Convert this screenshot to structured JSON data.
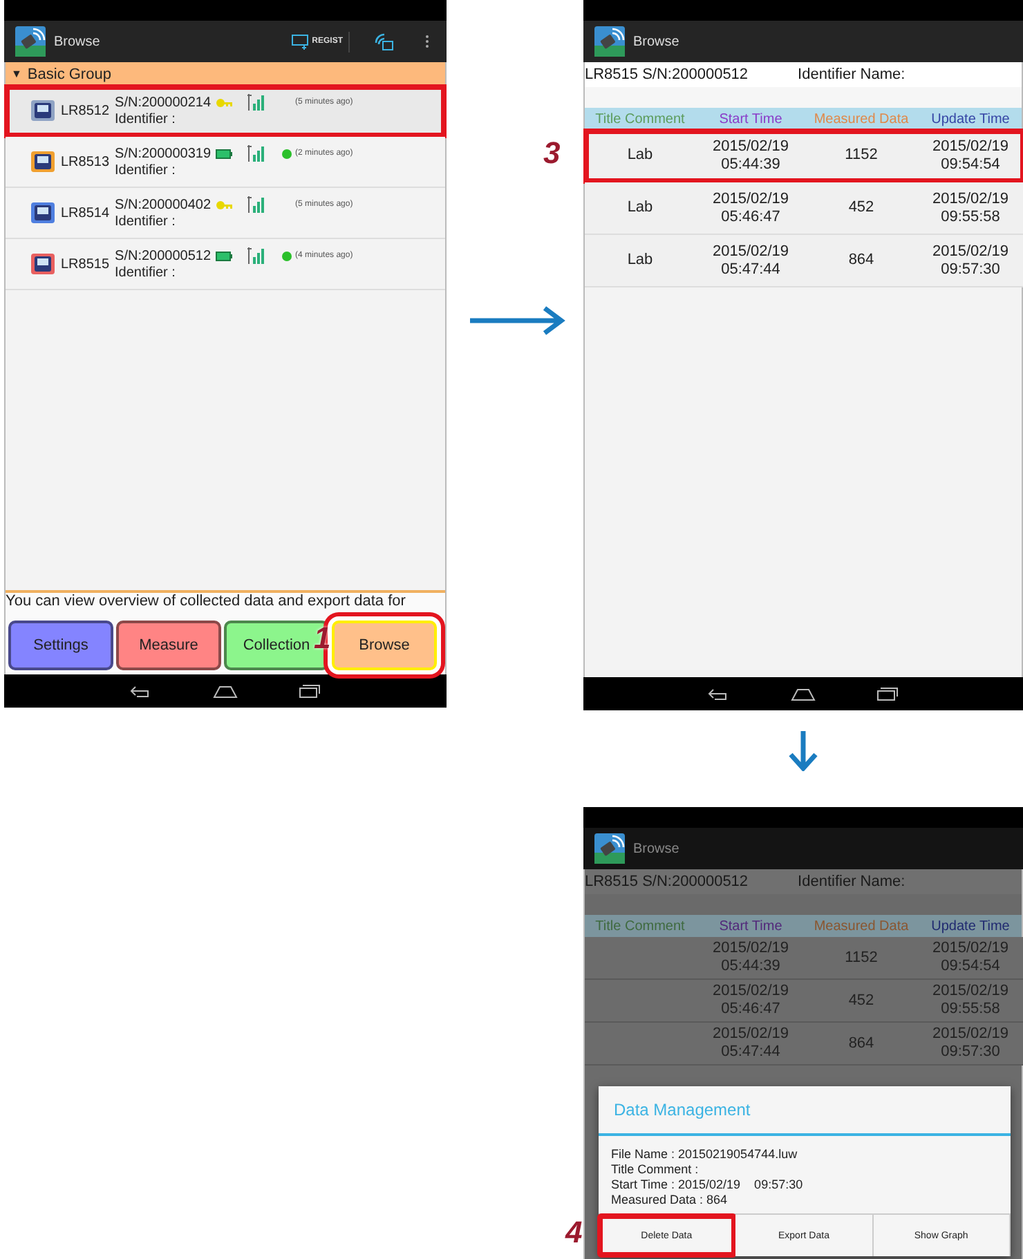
{
  "device_list_screen": {
    "app_bar": {
      "title": "Browse",
      "regist_label": "REGIST"
    },
    "group": {
      "toggle": "▼",
      "label": "Basic Group"
    },
    "devices": [
      {
        "model": "LR8512",
        "serial": "S/N:200000214",
        "identifier": "Identifier :",
        "updated": "(5 minutes ago)",
        "color": "#8fa3c4",
        "kind": "key",
        "online": false,
        "highlighted": true
      },
      {
        "model": "LR8513",
        "serial": "S/N:200000319",
        "identifier": "Identifier :",
        "updated": "(2 minutes ago)",
        "color": "#f0a030",
        "kind": "battery",
        "online": true,
        "highlighted": false
      },
      {
        "model": "LR8514",
        "serial": "S/N:200000402",
        "identifier": "Identifier :",
        "updated": "(5 minutes ago)",
        "color": "#4f7fe0",
        "kind": "key",
        "online": false,
        "highlighted": false
      },
      {
        "model": "LR8515",
        "serial": "S/N:200000512",
        "identifier": "Identifier :",
        "updated": "(4 minutes ago)",
        "color": "#e86060",
        "kind": "battery",
        "online": true,
        "highlighted": false
      }
    ],
    "hint": "You can view overview of collected data and export data for",
    "tabs": [
      {
        "label": "Settings",
        "color": "#8484ff",
        "selected": false,
        "highlighted": false
      },
      {
        "label": "Measure",
        "color": "#ff8484",
        "selected": false,
        "highlighted": false
      },
      {
        "label": "Collection",
        "color": "#8cf58c",
        "selected": false,
        "highlighted": false
      },
      {
        "label": "Browse",
        "color": "#ffc08a",
        "selected": true,
        "highlighted": true,
        "step": "1"
      }
    ]
  },
  "data_list_screen": {
    "app_bar": {
      "title": "Browse"
    },
    "device": "LR8515 S/N:200000512",
    "identifier": "Identifier Name:",
    "columns": [
      {
        "label": "Title Comment",
        "color": "#5c9c5c"
      },
      {
        "label": "Start Time",
        "color": "#8a3cc8"
      },
      {
        "label": "Measured Data",
        "color": "#e0894a"
      },
      {
        "label": "Update Time",
        "color": "#3545a5"
      }
    ],
    "rows": [
      {
        "comment": "Lab",
        "start": "2015/02/19\n05:44:39",
        "measured": "1152",
        "update": "2015/02/19\n09:54:54",
        "highlighted": true,
        "step": "3"
      },
      {
        "comment": "Lab",
        "start": "2015/02/19\n05:46:47",
        "measured": "452",
        "update": "2015/02/19\n09:55:58",
        "highlighted": false
      },
      {
        "comment": "Lab",
        "start": "2015/02/19\n05:47:44",
        "measured": "864",
        "update": "2015/02/19\n09:57:30",
        "highlighted": false
      }
    ]
  },
  "dialog_screen": {
    "app_bar": {
      "title": "Browse"
    },
    "device": "LR8515 S/N:200000512",
    "identifier": "Identifier Name:",
    "columns": [
      {
        "label": "Title Comment",
        "color": "#3f6a3f"
      },
      {
        "label": "Start Time",
        "color": "#52287a"
      },
      {
        "label": "Measured Data",
        "color": "#8a5630"
      },
      {
        "label": "Update Time",
        "color": "#202a70"
      }
    ],
    "rows": [
      {
        "start": "2015/02/19\n05:44:39",
        "measured": "1152",
        "update": "2015/02/19\n09:54:54"
      },
      {
        "start": "2015/02/19\n05:46:47",
        "measured": "452",
        "update": "2015/02/19\n09:55:58"
      },
      {
        "start": "2015/02/19\n05:47:44",
        "measured": "864",
        "update": "2015/02/19\n09:57:30"
      }
    ],
    "dialog": {
      "title": "Data Management",
      "lines": [
        "File Name : 20150219054744.luw",
        "Title Comment :",
        "Start Time : 2015/02/19    09:57:30",
        "Measured Data : 864"
      ],
      "buttons": [
        {
          "label": "Delete Data",
          "highlighted": true,
          "step": "4"
        },
        {
          "label": "Export Data",
          "highlighted": false
        },
        {
          "label": "Show Graph",
          "highlighted": false
        }
      ]
    }
  }
}
